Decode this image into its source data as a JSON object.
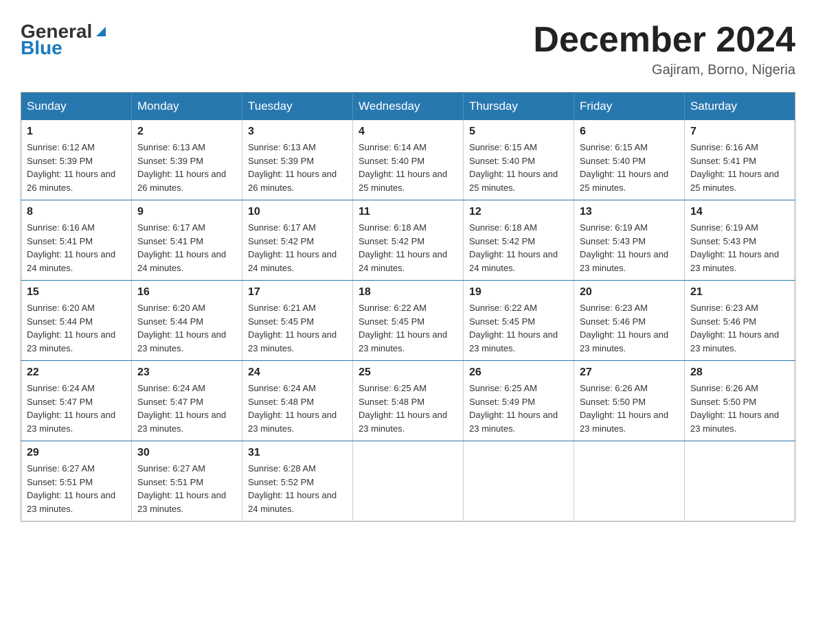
{
  "header": {
    "logo_general": "General",
    "logo_blue": "Blue",
    "title": "December 2024",
    "location": "Gajiram, Borno, Nigeria"
  },
  "days_of_week": [
    "Sunday",
    "Monday",
    "Tuesday",
    "Wednesday",
    "Thursday",
    "Friday",
    "Saturday"
  ],
  "weeks": [
    [
      {
        "day": "1",
        "sunrise": "6:12 AM",
        "sunset": "5:39 PM",
        "daylight": "11 hours and 26 minutes."
      },
      {
        "day": "2",
        "sunrise": "6:13 AM",
        "sunset": "5:39 PM",
        "daylight": "11 hours and 26 minutes."
      },
      {
        "day": "3",
        "sunrise": "6:13 AM",
        "sunset": "5:39 PM",
        "daylight": "11 hours and 26 minutes."
      },
      {
        "day": "4",
        "sunrise": "6:14 AM",
        "sunset": "5:40 PM",
        "daylight": "11 hours and 25 minutes."
      },
      {
        "day": "5",
        "sunrise": "6:15 AM",
        "sunset": "5:40 PM",
        "daylight": "11 hours and 25 minutes."
      },
      {
        "day": "6",
        "sunrise": "6:15 AM",
        "sunset": "5:40 PM",
        "daylight": "11 hours and 25 minutes."
      },
      {
        "day": "7",
        "sunrise": "6:16 AM",
        "sunset": "5:41 PM",
        "daylight": "11 hours and 25 minutes."
      }
    ],
    [
      {
        "day": "8",
        "sunrise": "6:16 AM",
        "sunset": "5:41 PM",
        "daylight": "11 hours and 24 minutes."
      },
      {
        "day": "9",
        "sunrise": "6:17 AM",
        "sunset": "5:41 PM",
        "daylight": "11 hours and 24 minutes."
      },
      {
        "day": "10",
        "sunrise": "6:17 AM",
        "sunset": "5:42 PM",
        "daylight": "11 hours and 24 minutes."
      },
      {
        "day": "11",
        "sunrise": "6:18 AM",
        "sunset": "5:42 PM",
        "daylight": "11 hours and 24 minutes."
      },
      {
        "day": "12",
        "sunrise": "6:18 AM",
        "sunset": "5:42 PM",
        "daylight": "11 hours and 24 minutes."
      },
      {
        "day": "13",
        "sunrise": "6:19 AM",
        "sunset": "5:43 PM",
        "daylight": "11 hours and 23 minutes."
      },
      {
        "day": "14",
        "sunrise": "6:19 AM",
        "sunset": "5:43 PM",
        "daylight": "11 hours and 23 minutes."
      }
    ],
    [
      {
        "day": "15",
        "sunrise": "6:20 AM",
        "sunset": "5:44 PM",
        "daylight": "11 hours and 23 minutes."
      },
      {
        "day": "16",
        "sunrise": "6:20 AM",
        "sunset": "5:44 PM",
        "daylight": "11 hours and 23 minutes."
      },
      {
        "day": "17",
        "sunrise": "6:21 AM",
        "sunset": "5:45 PM",
        "daylight": "11 hours and 23 minutes."
      },
      {
        "day": "18",
        "sunrise": "6:22 AM",
        "sunset": "5:45 PM",
        "daylight": "11 hours and 23 minutes."
      },
      {
        "day": "19",
        "sunrise": "6:22 AM",
        "sunset": "5:45 PM",
        "daylight": "11 hours and 23 minutes."
      },
      {
        "day": "20",
        "sunrise": "6:23 AM",
        "sunset": "5:46 PM",
        "daylight": "11 hours and 23 minutes."
      },
      {
        "day": "21",
        "sunrise": "6:23 AM",
        "sunset": "5:46 PM",
        "daylight": "11 hours and 23 minutes."
      }
    ],
    [
      {
        "day": "22",
        "sunrise": "6:24 AM",
        "sunset": "5:47 PM",
        "daylight": "11 hours and 23 minutes."
      },
      {
        "day": "23",
        "sunrise": "6:24 AM",
        "sunset": "5:47 PM",
        "daylight": "11 hours and 23 minutes."
      },
      {
        "day": "24",
        "sunrise": "6:24 AM",
        "sunset": "5:48 PM",
        "daylight": "11 hours and 23 minutes."
      },
      {
        "day": "25",
        "sunrise": "6:25 AM",
        "sunset": "5:48 PM",
        "daylight": "11 hours and 23 minutes."
      },
      {
        "day": "26",
        "sunrise": "6:25 AM",
        "sunset": "5:49 PM",
        "daylight": "11 hours and 23 minutes."
      },
      {
        "day": "27",
        "sunrise": "6:26 AM",
        "sunset": "5:50 PM",
        "daylight": "11 hours and 23 minutes."
      },
      {
        "day": "28",
        "sunrise": "6:26 AM",
        "sunset": "5:50 PM",
        "daylight": "11 hours and 23 minutes."
      }
    ],
    [
      {
        "day": "29",
        "sunrise": "6:27 AM",
        "sunset": "5:51 PM",
        "daylight": "11 hours and 23 minutes."
      },
      {
        "day": "30",
        "sunrise": "6:27 AM",
        "sunset": "5:51 PM",
        "daylight": "11 hours and 23 minutes."
      },
      {
        "day": "31",
        "sunrise": "6:28 AM",
        "sunset": "5:52 PM",
        "daylight": "11 hours and 24 minutes."
      },
      null,
      null,
      null,
      null
    ]
  ]
}
